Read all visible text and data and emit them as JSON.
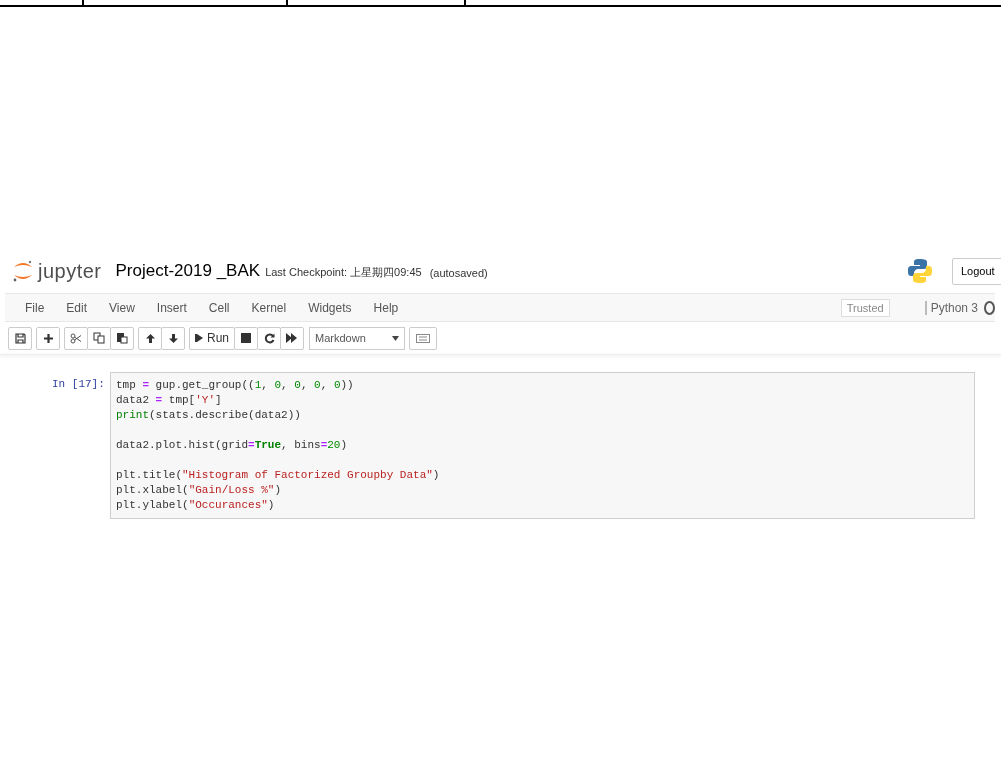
{
  "header": {
    "logo_text": "jupyter",
    "notebook_title": "Project-2019 _BAK",
    "checkpoint": "Last Checkpoint: 上星期四09:45",
    "autosave": "(autosaved)",
    "logout": "Logout"
  },
  "menubar": {
    "items": [
      "File",
      "Edit",
      "View",
      "Insert",
      "Cell",
      "Kernel",
      "Widgets",
      "Help"
    ],
    "trusted": "Trusted",
    "kernel": "Python 3"
  },
  "toolbar": {
    "run_label": "Run",
    "cell_type": "Markdown"
  },
  "cell": {
    "prompt": "In [17]:",
    "lines": [
      {
        "kind": "code",
        "tokens": [
          {
            "t": "tmp ",
            "kind": "plain"
          },
          {
            "t": "=",
            "kind": "op"
          },
          {
            "t": " gup.get_group((",
            "kind": "plain"
          },
          {
            "t": "1",
            "kind": "num"
          },
          {
            "t": ", ",
            "kind": "plain"
          },
          {
            "t": "0",
            "kind": "num"
          },
          {
            "t": ", ",
            "kind": "plain"
          },
          {
            "t": "0",
            "kind": "num"
          },
          {
            "t": ", ",
            "kind": "plain"
          },
          {
            "t": "0",
            "kind": "num"
          },
          {
            "t": ", ",
            "kind": "plain"
          },
          {
            "t": "0",
            "kind": "num"
          },
          {
            "t": "))",
            "kind": "plain"
          }
        ]
      },
      {
        "kind": "code",
        "tokens": [
          {
            "t": "data2 ",
            "kind": "plain"
          },
          {
            "t": "=",
            "kind": "op"
          },
          {
            "t": " tmp[",
            "kind": "plain"
          },
          {
            "t": "'Y'",
            "kind": "str"
          },
          {
            "t": "]",
            "kind": "plain"
          }
        ]
      },
      {
        "kind": "code",
        "tokens": [
          {
            "t": "print",
            "kind": "builtin"
          },
          {
            "t": "(stats.describe(data2))",
            "kind": "plain"
          }
        ]
      },
      {
        "kind": "blank"
      },
      {
        "kind": "code",
        "tokens": [
          {
            "t": "data2.plot.hist(grid",
            "kind": "plain"
          },
          {
            "t": "=",
            "kind": "op"
          },
          {
            "t": "True",
            "kind": "keyword"
          },
          {
            "t": ", bins",
            "kind": "plain"
          },
          {
            "t": "=",
            "kind": "op"
          },
          {
            "t": "20",
            "kind": "num"
          },
          {
            "t": ")",
            "kind": "plain"
          }
        ]
      },
      {
        "kind": "blank"
      },
      {
        "kind": "code",
        "tokens": [
          {
            "t": "plt.title(",
            "kind": "plain"
          },
          {
            "t": "\"Histogram of Factorized Groupby Data\"",
            "kind": "str"
          },
          {
            "t": ")",
            "kind": "plain"
          }
        ]
      },
      {
        "kind": "code",
        "tokens": [
          {
            "t": "plt.xlabel(",
            "kind": "plain"
          },
          {
            "t": "\"Gain/Loss %\"",
            "kind": "str"
          },
          {
            "t": ")",
            "kind": "plain"
          }
        ]
      },
      {
        "kind": "code",
        "tokens": [
          {
            "t": "plt.ylabel(",
            "kind": "plain"
          },
          {
            "t": "\"Occurances\"",
            "kind": "str"
          },
          {
            "t": ")",
            "kind": "plain"
          }
        ]
      }
    ]
  }
}
